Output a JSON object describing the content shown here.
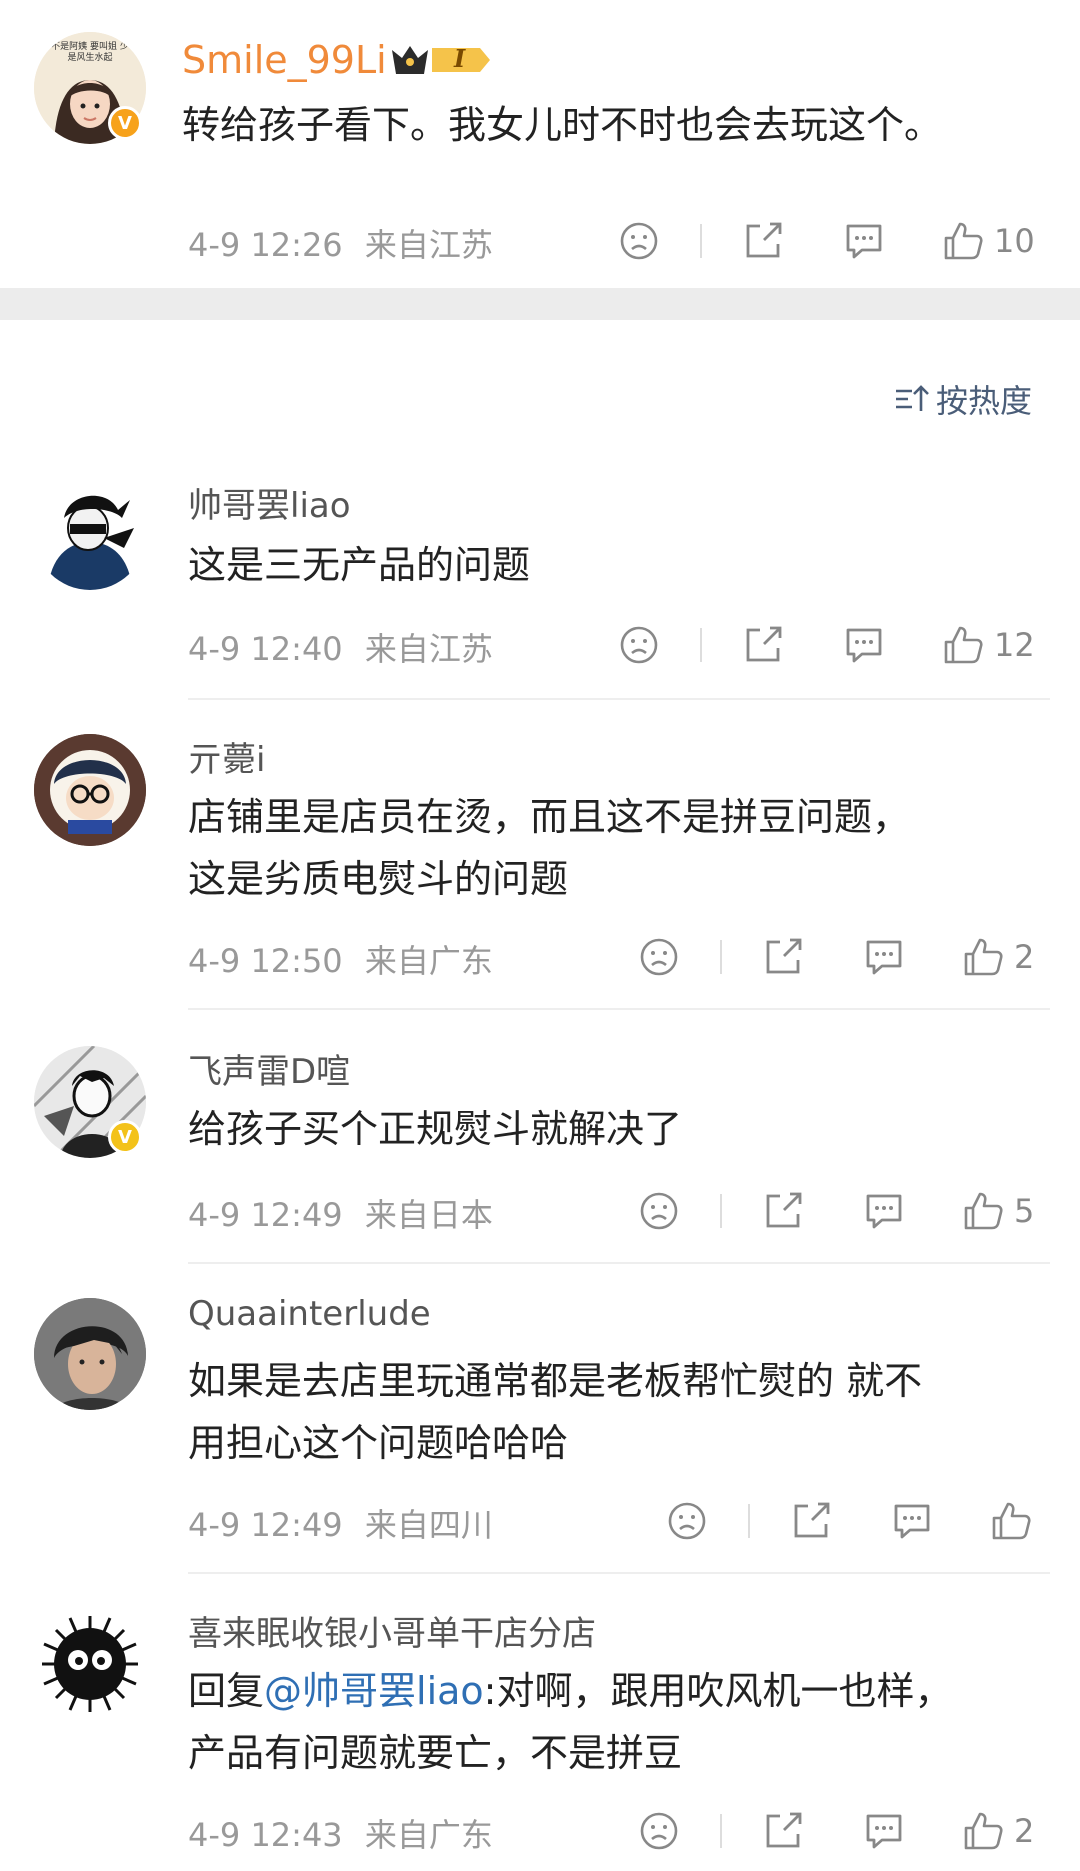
{
  "top_comment": {
    "username": "Smile_99Li",
    "avatar_caption": "不是阿姨 要叫姐 少是风生水起",
    "level_badge": "I",
    "text": "转给孩子看下。我女儿时不时也会去玩这个。",
    "time": "4-9 12:26",
    "location": "来自江苏",
    "likes": "10"
  },
  "sort_label": "按热度",
  "comments": [
    {
      "username": "帅哥罢liao",
      "lines": [
        "这是三无产品的问题"
      ],
      "time": "4-9 12:40",
      "location": "来自江苏",
      "likes": "12"
    },
    {
      "username": "亓薨i",
      "lines": [
        "店铺里是店员在烫，而且这不是拼豆问题，",
        "这是劣质电熨斗的问题"
      ],
      "time": "4-9 12:50",
      "location": "来自广东",
      "likes": "2"
    },
    {
      "username": "飞声雷D喧",
      "lines": [
        "给孩子买个正规熨斗就解决了"
      ],
      "time": "4-9 12:49",
      "location": "来自日本",
      "likes": "5"
    },
    {
      "username": "Quaainterlude",
      "lines": [
        "如果是去店里玩通常都是老板帮忙熨的 就不",
        "用担心这个问题哈哈哈"
      ],
      "time": "4-9 12:49",
      "location": "来自四川",
      "likes": ""
    },
    {
      "username": "喜来眠收银小哥单干店分店",
      "reply_prefix": "回复",
      "reply_mention": "@帅哥罢liao",
      "reply_rest": ":对啊，跟用吹风机一也样，",
      "lines": [
        "产品有问题就要亡，不是拼豆"
      ],
      "time": "4-9 12:43",
      "location": "来自广东",
      "likes": "2"
    }
  ],
  "icons": {
    "dislike": "sad-face-icon",
    "share": "share-icon",
    "comment": "comment-icon",
    "like": "thumbs-up-icon",
    "verified": "verified-v-icon",
    "sort": "sort-icon"
  },
  "colors": {
    "username_vip": "#f08a3a",
    "mention": "#2f6fb4",
    "sort": "#4a5d78",
    "verified_badge": "#f7a21b"
  }
}
